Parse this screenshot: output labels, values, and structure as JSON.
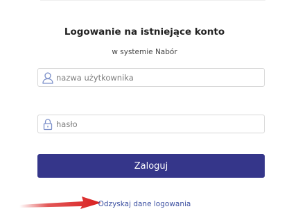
{
  "login": {
    "title": "Logowanie na istniejące konto",
    "subtitle": "w systemie Nabór",
    "username_placeholder": "nazwa użytkownika",
    "password_placeholder": "hasło",
    "submit_label": "Zaloguj",
    "recover_link": "Odzyskaj dane logowania"
  },
  "colors": {
    "button": "#35368a",
    "link": "#3a4ea0",
    "icon": "#7b8fc9",
    "arrow": "#d91f1f"
  },
  "icons": {
    "username": "user-icon",
    "password": "lock-icon",
    "annotation": "arrow-icon"
  }
}
